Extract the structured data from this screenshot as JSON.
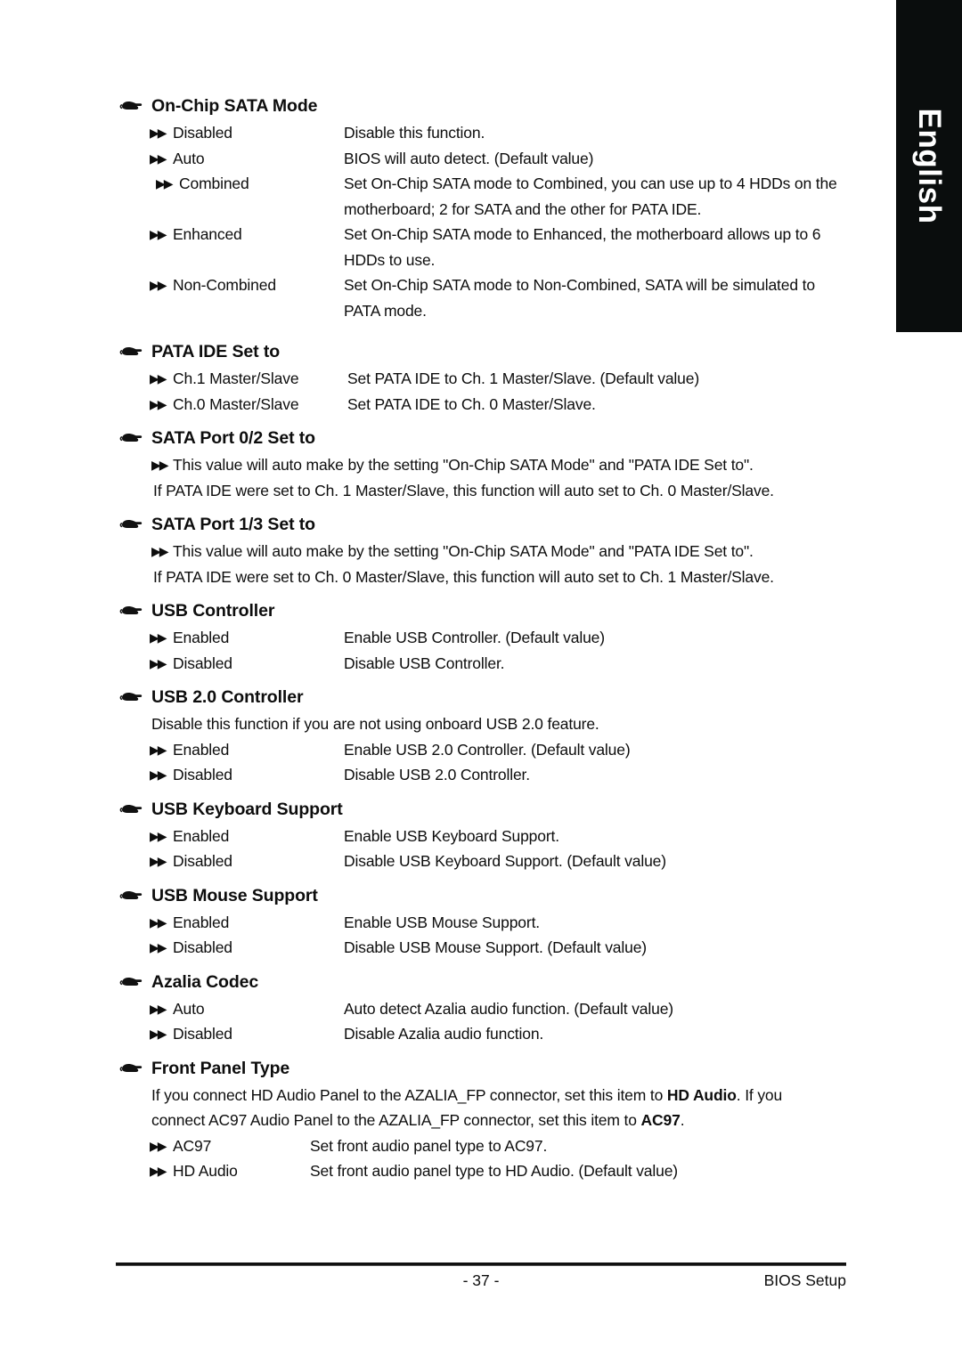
{
  "language_tab": {
    "label": "English"
  },
  "footer": {
    "page_number": "- 37 -",
    "right_label": "BIOS Setup"
  },
  "icons": {
    "section_marker": "pointing-hand-icon",
    "option_bullet": "double-triangle-bullet-icon"
  },
  "sections": [
    {
      "id": "on-chip-sata-mode",
      "title": "On-Chip SATA Mode",
      "options": [
        {
          "label": "Disabled",
          "desc": "Disable this function."
        },
        {
          "label": "Auto",
          "desc": "BIOS will auto detect.  (Default value)"
        },
        {
          "label": "Combined",
          "desc": "Set On-Chip SATA mode to Combined, you can use up to 4 HDDs on the",
          "cont": "motherboard; 2 for SATA and the other for PATA IDE."
        },
        {
          "label": "Enhanced",
          "desc": "Set On-Chip SATA mode to Enhanced, the motherboard allows up to 6",
          "cont": "HDDs to use."
        },
        {
          "label": "Non-Combined",
          "desc": "Set On-Chip SATA mode to Non-Combined, SATA will be simulated to",
          "cont": "PATA mode."
        }
      ]
    },
    {
      "id": "pata-ide-set-to",
      "title": "PATA IDE Set to",
      "options": [
        {
          "label": "Ch.1 Master/Slave",
          "desc": "Set PATA IDE to Ch. 1 Master/Slave. (Default value)"
        },
        {
          "label": "Ch.0 Master/Slave",
          "desc": "Set PATA IDE to Ch. 0 Master/Slave."
        }
      ]
    },
    {
      "id": "sata-port-0-2-set-to",
      "title": "SATA Port 0/2 Set to",
      "bullet_line": "This value will auto make by the setting \"On-Chip SATA Mode\" and \"PATA IDE Set to\".",
      "plain_line": "If PATA IDE were set to Ch. 1 Master/Slave, this function will auto set to Ch. 0 Master/Slave."
    },
    {
      "id": "sata-port-1-3-set-to",
      "title": "SATA Port 1/3 Set to",
      "bullet_line": "This value will auto make by the setting \"On-Chip SATA Mode\" and \"PATA IDE Set to\".",
      "plain_line": "If PATA IDE were set to Ch. 0 Master/Slave, this function will auto set to Ch. 1 Master/Slave."
    },
    {
      "id": "usb-controller",
      "title": "USB Controller",
      "options": [
        {
          "label": "Enabled",
          "desc": "Enable USB Controller. (Default value)"
        },
        {
          "label": "Disabled",
          "desc": "Disable USB Controller."
        }
      ]
    },
    {
      "id": "usb-2-0-controller",
      "title": "USB 2.0 Controller",
      "note": "Disable this function if you are not using onboard USB 2.0 feature.",
      "options": [
        {
          "label": "Enabled",
          "desc": "Enable USB 2.0 Controller. (Default value)"
        },
        {
          "label": "Disabled",
          "desc": "Disable USB 2.0 Controller."
        }
      ]
    },
    {
      "id": "usb-keyboard-support",
      "title": "USB Keyboard Support",
      "options": [
        {
          "label": "Enabled",
          "desc": "Enable USB Keyboard Support."
        },
        {
          "label": "Disabled",
          "desc": "Disable USB Keyboard Support. (Default value)"
        }
      ]
    },
    {
      "id": "usb-mouse-support",
      "title": "USB Mouse Support",
      "options": [
        {
          "label": "Enabled",
          "desc": "Enable USB Mouse Support."
        },
        {
          "label": "Disabled",
          "desc": "Disable USB Mouse Support. (Default value)"
        }
      ]
    },
    {
      "id": "azalia-codec",
      "title": "Azalia Codec",
      "options": [
        {
          "label": "Auto",
          "desc": "Auto detect Azalia audio function. (Default value)"
        },
        {
          "label": "Disabled",
          "desc": "Disable Azalia audio function."
        }
      ]
    },
    {
      "id": "front-panel-type",
      "title": "Front Panel Type",
      "note_rich_1a": "If you connect HD Audio Panel to the AZALIA_FP connector, set this item to ",
      "note_rich_1b": "HD Audio",
      "note_rich_1c": ". If you",
      "note_rich_2a": "connect AC97 Audio Panel to the AZALIA_FP connector, set this item to ",
      "note_rich_2b": "AC97",
      "note_rich_2c": ".",
      "options": [
        {
          "label": "AC97",
          "desc": "Set front audio panel type to AC97."
        },
        {
          "label": "HD Audio",
          "desc": "Set front audio panel type to HD Audio. (Default value)"
        }
      ]
    }
  ]
}
